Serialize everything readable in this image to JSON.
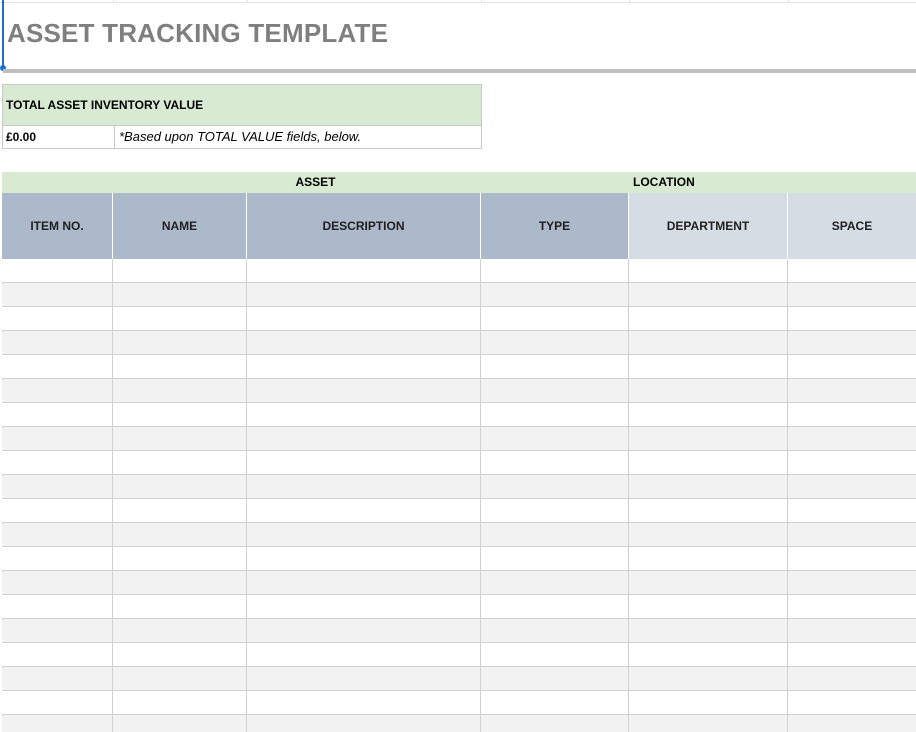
{
  "sheet": {
    "title": "ASSET TRACKING TEMPLATE"
  },
  "summary": {
    "label": "TOTAL ASSET INVENTORY VALUE",
    "value": "£0.00",
    "note": "*Based upon TOTAL VALUE fields, below."
  },
  "groups": {
    "asset": "ASSET",
    "location": "LOCATION"
  },
  "columns": [
    {
      "key": "item_no",
      "label": "ITEM NO.",
      "group": "asset"
    },
    {
      "key": "name",
      "label": "NAME",
      "group": "asset"
    },
    {
      "key": "description",
      "label": "DESCRIPTION",
      "group": "asset"
    },
    {
      "key": "type",
      "label": "TYPE",
      "group": "asset"
    },
    {
      "key": "department",
      "label": "DEPARTMENT",
      "group": "location"
    },
    {
      "key": "space",
      "label": "SPACE",
      "group": "location"
    }
  ],
  "rows": [
    [
      "",
      "",
      "",
      "",
      "",
      ""
    ],
    [
      "",
      "",
      "",
      "",
      "",
      ""
    ],
    [
      "",
      "",
      "",
      "",
      "",
      ""
    ],
    [
      "",
      "",
      "",
      "",
      "",
      ""
    ],
    [
      "",
      "",
      "",
      "",
      "",
      ""
    ],
    [
      "",
      "",
      "",
      "",
      "",
      ""
    ],
    [
      "",
      "",
      "",
      "",
      "",
      ""
    ],
    [
      "",
      "",
      "",
      "",
      "",
      ""
    ],
    [
      "",
      "",
      "",
      "",
      "",
      ""
    ],
    [
      "",
      "",
      "",
      "",
      "",
      ""
    ],
    [
      "",
      "",
      "",
      "",
      "",
      ""
    ],
    [
      "",
      "",
      "",
      "",
      "",
      ""
    ],
    [
      "",
      "",
      "",
      "",
      "",
      ""
    ],
    [
      "",
      "",
      "",
      "",
      "",
      ""
    ],
    [
      "",
      "",
      "",
      "",
      "",
      ""
    ],
    [
      "",
      "",
      "",
      "",
      "",
      ""
    ],
    [
      "",
      "",
      "",
      "",
      "",
      ""
    ],
    [
      "",
      "",
      "",
      "",
      "",
      ""
    ],
    [
      "",
      "",
      "",
      "",
      "",
      ""
    ],
    [
      "",
      "",
      "",
      "",
      "",
      ""
    ]
  ],
  "colors": {
    "title": "#7f7f7f",
    "summary_header": "#d9ead3",
    "group_header": "#d9ead3",
    "asset_header": "#acb9ca",
    "location_header": "#d6dce4",
    "alt_row": "#f2f2f2",
    "selection": "#1f6fd1"
  }
}
